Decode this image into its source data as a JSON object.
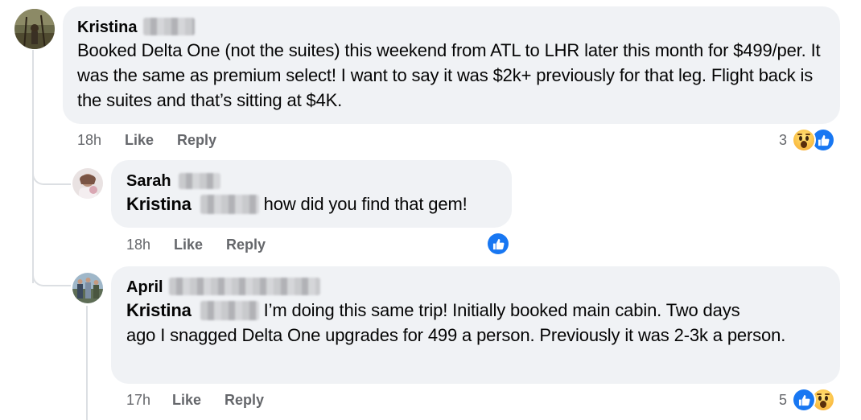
{
  "comments": [
    {
      "author": "Kristina",
      "text": "Booked Delta One (not the suites) this weekend from ATL to LHR later this month for $499/per. It was the same as premium select! I want to say it was $2k+ previously for that leg. Flight back is the suites and that’s sitting at $4K.",
      "time": "18h",
      "like_label": "Like",
      "reply_label": "Reply",
      "reaction_count": "3",
      "reactions": [
        "wow-icon",
        "like-icon"
      ]
    },
    {
      "author": "Sarah",
      "mention": "Kristina",
      "text": "how did you find that gem!",
      "time": "18h",
      "like_label": "Like",
      "reply_label": "Reply",
      "reactions": [
        "like-icon"
      ]
    },
    {
      "author": "April",
      "mention": "Kristina",
      "text_line1": "I’m doing this same trip! Initially booked main cabin. Two days",
      "text_rest": "ago I snagged Delta One upgrades for 499 a person. Previously it was 2-3k a person.",
      "time": "17h",
      "like_label": "Like",
      "reply_label": "Reply",
      "reaction_count": "5",
      "reactions": [
        "like-icon",
        "wow-icon"
      ]
    }
  ],
  "colors": {
    "bubble": "#f0f2f5",
    "meta_text": "#65676b",
    "like_blue": "#1877f2",
    "thread_line": "#dcdfe3"
  }
}
